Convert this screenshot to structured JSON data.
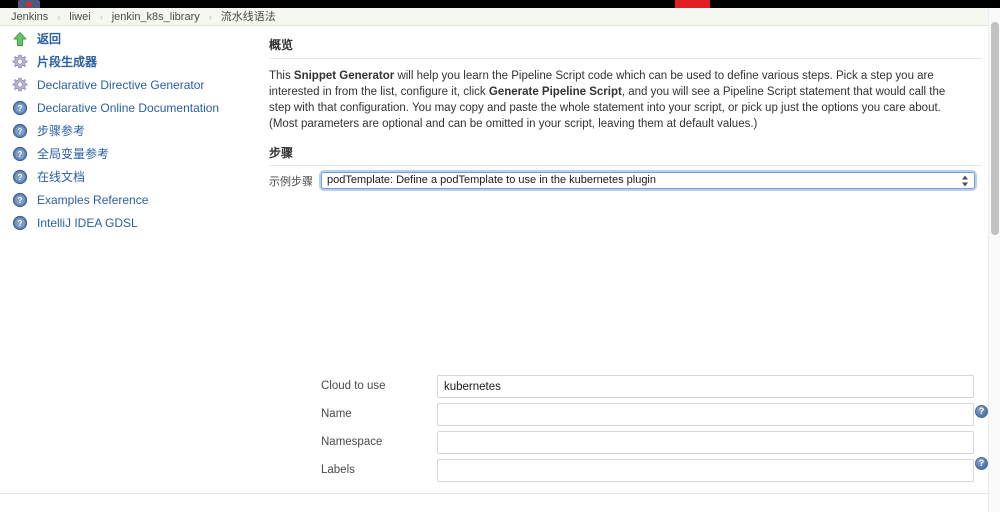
{
  "browser": {
    "favicon_name": "jenkins-favicon",
    "tab_marker_color": "#e02020",
    "bar_color": "#000000"
  },
  "breadcrumb": {
    "separator": "›",
    "items": [
      {
        "label": "Jenkins"
      },
      {
        "label": "liwei"
      },
      {
        "label": "jenkin_k8s_library"
      },
      {
        "label": "流水线语法"
      }
    ]
  },
  "sidebar": {
    "items": [
      {
        "label": "返回",
        "icon": "up-arrow-icon",
        "bold": true
      },
      {
        "label": "片段生成器",
        "icon": "gear-icon",
        "bold": true
      },
      {
        "label": "Declarative Directive Generator",
        "icon": "gear-icon",
        "bold": false
      },
      {
        "label": "Declarative Online Documentation",
        "icon": "help-icon",
        "bold": false
      },
      {
        "label": "步骤参考",
        "icon": "help-icon",
        "bold": false
      },
      {
        "label": "全局变量参考",
        "icon": "help-icon",
        "bold": false
      },
      {
        "label": "在线文档",
        "icon": "help-icon",
        "bold": false
      },
      {
        "label": "Examples Reference",
        "icon": "help-icon",
        "bold": false
      },
      {
        "label": "IntelliJ IDEA GDSL",
        "icon": "help-icon",
        "bold": false
      }
    ]
  },
  "overview": {
    "heading": "概览",
    "text_1": "This ",
    "bold_1": "Snippet Generator",
    "text_2": " will help you learn the Pipeline Script code which can be used to define various steps. Pick a step you are interested in from the list, configure it, click ",
    "bold_2": "Generate Pipeline Script",
    "text_3": ", and you will see a Pipeline Script statement that would call the step with that configuration. You may copy and paste the whole statement into your script, or pick up just the options you care about. (Most parameters are optional and can be omitted in your script, leaving them at default values.)"
  },
  "steps": {
    "heading": "步骤",
    "select_label": "示例步骤",
    "selected_option": "podTemplate: Define a podTemplate to use in the kubernetes plugin"
  },
  "form": {
    "fields": [
      {
        "label": "Cloud to use",
        "value": "kubernetes",
        "placeholder": ""
      },
      {
        "label": "Name",
        "value": "",
        "placeholder": ""
      },
      {
        "label": "Namespace",
        "value": "",
        "placeholder": ""
      },
      {
        "label": "Labels",
        "value": "",
        "placeholder": ""
      }
    ],
    "help_label": "?"
  }
}
